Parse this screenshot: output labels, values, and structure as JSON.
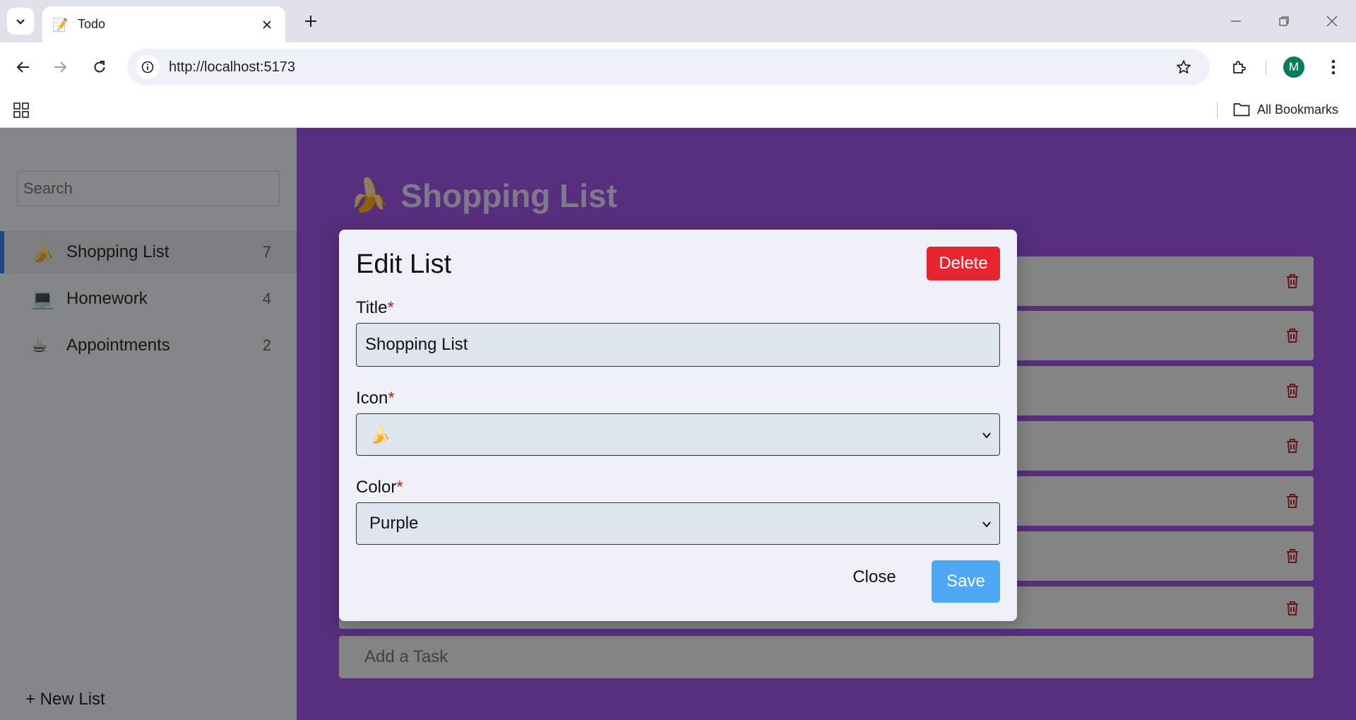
{
  "browser": {
    "tab_title": "Todo",
    "tab_favicon": "📝",
    "url": "http://localhost:5173",
    "profile_initial": "M",
    "bookmarks_label": "All Bookmarks",
    "icons": [
      "tab-search-icon",
      "close-icon",
      "plus-icon",
      "minimize-icon",
      "restore-icon",
      "back-icon",
      "forward-icon",
      "reload-icon",
      "info-icon",
      "star-icon",
      "extensions-icon",
      "menu-icon",
      "apps-icon",
      "folder-icon"
    ]
  },
  "sidebar": {
    "search_placeholder": "Search",
    "lists": [
      {
        "icon": "🍌",
        "label": "Shopping List",
        "count": "7",
        "active": true
      },
      {
        "icon": "💻",
        "label": "Homework",
        "count": "4",
        "active": false
      },
      {
        "icon": "☕",
        "label": "Appointments",
        "count": "2",
        "active": false
      }
    ],
    "new_list_label": "+ New List"
  },
  "main": {
    "icon": "🍌",
    "title": "Shopping List",
    "accent_color": "#9f54e4",
    "add_task_placeholder": "Add a Task"
  },
  "modal": {
    "title": "Edit List",
    "delete_label": "Delete",
    "title_label": "Title",
    "title_value": "Shopping List",
    "icon_label": "Icon",
    "icon_value": "🍌",
    "color_label": "Color",
    "color_value": "Purple",
    "required_mark": "*",
    "close_label": "Close",
    "save_label": "Save",
    "delete_color": "#e8252f",
    "save_color": "#4ea8f5"
  }
}
